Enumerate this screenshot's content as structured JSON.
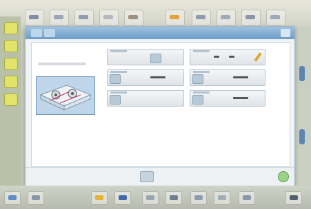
{
  "top_toolbar": {
    "tools": [
      {
        "icon": "cut-tool-icon",
        "color": "#7f8fa6"
      },
      {
        "icon": "measure-tool-icon",
        "color": "#9aa7b7"
      },
      {
        "icon": "rotate-tool-icon",
        "color": "#8f9cb0"
      },
      {
        "icon": "screw-tool-icon",
        "color": "#b2b7c0"
      },
      {
        "icon": "flip-tool-icon",
        "color": "#9e8f80"
      },
      {
        "icon": "highlight-tool-icon",
        "color": "#e2a33b"
      },
      {
        "icon": "align-tool-icon",
        "color": "#8c9bb0"
      },
      {
        "icon": "distance-tool-icon",
        "color": "#a1a9b6"
      },
      {
        "icon": "angle-tool-icon",
        "color": "#8996aa"
      },
      {
        "icon": "export-tool-icon",
        "color": "#9da8b8"
      }
    ]
  },
  "left_strip": {
    "tools": [
      {
        "icon": "select-tool-icon",
        "color": "#e2e36a"
      },
      {
        "icon": "layer-tool-icon",
        "color": "#dfe169"
      },
      {
        "icon": "pen-tool-icon",
        "color": "#e2e36a"
      },
      {
        "icon": "dot-tool-icon",
        "color": "#e2e36a"
      },
      {
        "icon": "text-tool-icon",
        "color": "#dfe169"
      }
    ]
  },
  "dialog": {
    "title": "",
    "accent_color": "#6d9cc8",
    "settings_left": [
      "",
      "",
      ""
    ],
    "settings_right": [
      "",
      "",
      ""
    ]
  },
  "taskbar": {
    "tools": [
      {
        "icon": "open-folder-icon",
        "color": "#5e8cc4"
      },
      {
        "icon": "view-tool-icon",
        "color": "#8a96a8"
      },
      {
        "icon": "draw-tool-icon",
        "color": "#e3b236"
      },
      {
        "icon": "save-icon",
        "color": "#3f6aa6"
      },
      {
        "icon": "arrow-tool-icon",
        "color": "#9aa5b3"
      },
      {
        "icon": "scan-tool-icon",
        "color": "#6f7d90"
      },
      {
        "icon": "image-tool-icon",
        "color": "#8c9caf"
      },
      {
        "icon": "report-tool-icon",
        "color": "#a2acba"
      },
      {
        "icon": "print-tool-icon",
        "color": "#8797aa"
      },
      {
        "icon": "camera-icon",
        "color": "#55606e"
      }
    ]
  }
}
